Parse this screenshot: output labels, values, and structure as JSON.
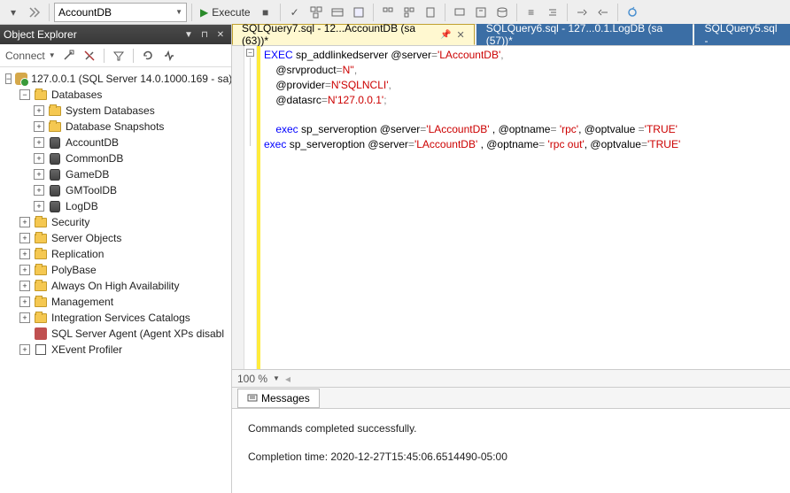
{
  "toolbar": {
    "database_combo": "AccountDB",
    "execute_label": "Execute"
  },
  "object_explorer": {
    "title": "Object Explorer",
    "connect_label": "Connect",
    "server": "127.0.0.1 (SQL Server 14.0.1000.169 - sa)",
    "databases_label": "Databases",
    "system_databases": "System Databases",
    "database_snapshots": "Database Snapshots",
    "db_account": "AccountDB",
    "db_common": "CommonDB",
    "db_game": "GameDB",
    "db_gmtool": "GMToolDB",
    "db_log": "LogDB",
    "security": "Security",
    "server_objects": "Server Objects",
    "replication": "Replication",
    "polybase": "PolyBase",
    "always_on": "Always On High Availability",
    "management": "Management",
    "integration": "Integration Services Catalogs",
    "agent": "SQL Server Agent (Agent XPs disabl",
    "xevent": "XEvent Profiler"
  },
  "tabs": {
    "t1": "SQLQuery7.sql - 12...AccountDB (sa (63))*",
    "t2": "SQLQuery6.sql - 127...0.1.LogDB (sa (57))*",
    "t3": "SQLQuery5.sql -"
  },
  "code": {
    "l1a": "EXEC",
    "l1b": " sp_addlinkedserver @server",
    "l1c": "=",
    "l1d": "'LAccountDB'",
    "l1e": ",",
    "l2a": "    @srvproduct",
    "l2b": "=",
    "l2c": "N''",
    "l2d": ",",
    "l3a": "    @provider",
    "l3b": "=",
    "l3c": "N'SQLNCLI'",
    "l3d": ",",
    "l4a": "    @datasrc",
    "l4b": "=",
    "l4c": "N'127.0.0.1'",
    "l4d": ";",
    "l6a": "    exec",
    "l6b": " sp_serveroption @server",
    "l6c": "=",
    "l6d": "'LAccountDB'",
    "l6e": " , @optname",
    "l6f": "=",
    "l6g": " 'rpc'",
    "l6h": ", @optvalue ",
    "l6i": "=",
    "l6j": "'TRUE'",
    "l7a": "exec",
    "l7b": " sp_serveroption @server",
    "l7c": "=",
    "l7d": "'LAccountDB'",
    "l7e": " , @optname",
    "l7f": "=",
    "l7g": " 'rpc out'",
    "l7h": ", @optvalue",
    "l7i": "=",
    "l7j": "'TRUE'"
  },
  "zoom": {
    "value": "100 %"
  },
  "messages": {
    "tab_label": "Messages",
    "line1": "Commands completed successfully.",
    "line2": "Completion time: 2020-12-27T15:45:06.6514490-05:00"
  }
}
